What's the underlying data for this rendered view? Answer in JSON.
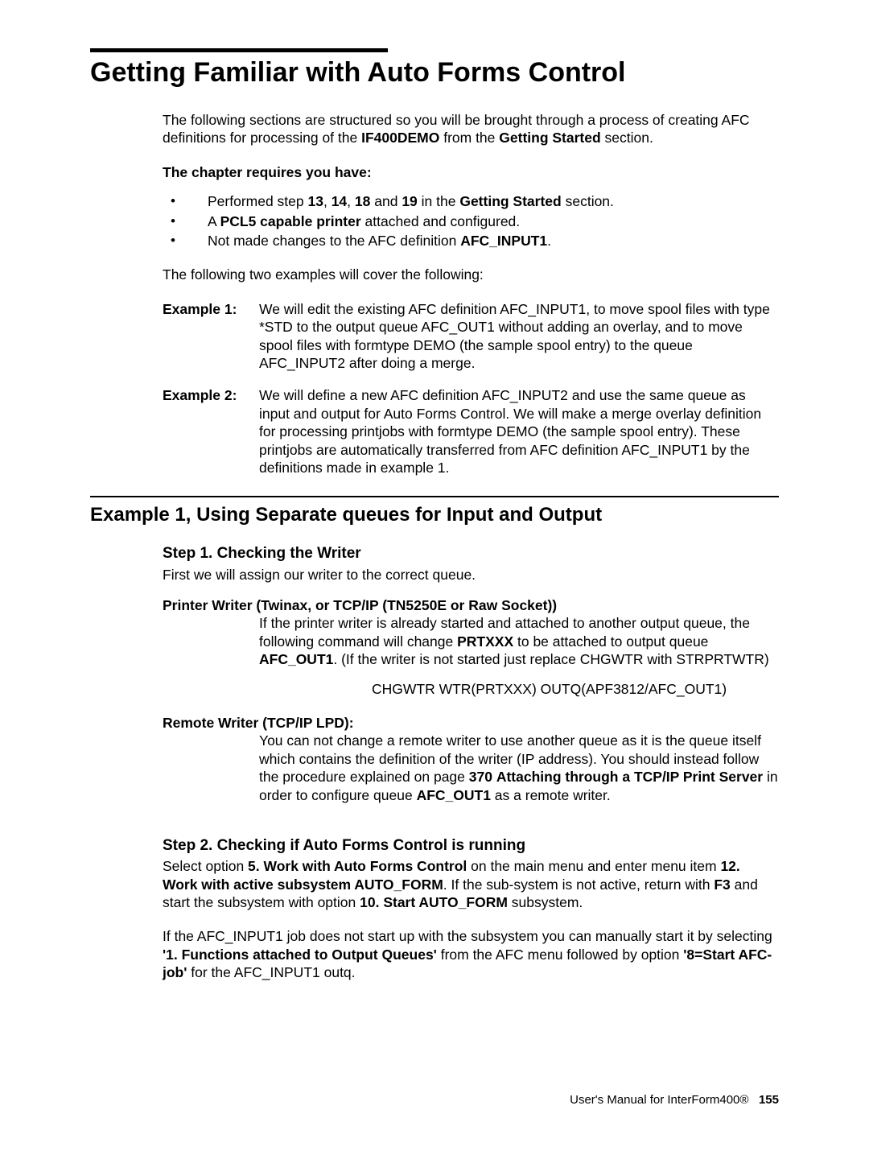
{
  "title": "Getting Familiar with Auto Forms Control",
  "intro": {
    "p1a": "The following sections are structured so you will be brought through a process of creating AFC definitions for processing of the ",
    "p1b": "IF400DEMO",
    "p1c": " from the ",
    "p1d": "Getting Started",
    "p1e": " section.",
    "req_head": "The chapter requires you have:",
    "req1a": "Performed step ",
    "req1_13": "13",
    "req1_c1": ", ",
    "req1_14": "14",
    "req1_c2": ", ",
    "req1_18": "18",
    "req1_and": " and ",
    "req1_19": "19",
    "req1_in": " in the ",
    "req1_gs": "Getting Started",
    "req1_end": " section.",
    "req2a": "A ",
    "req2b": "PCL5 capable printer",
    "req2c": " attached and configured.",
    "req3a": "Not made changes to the AFC definition ",
    "req3b": "AFC_INPUT1",
    "req3c": ".",
    "cover": "The following two examples will cover the following:",
    "ex1_label": "Example 1:",
    "ex1_text": "We will edit the existing AFC definition AFC_INPUT1, to move spool files with type *STD to the output queue AFC_OUT1 without adding an overlay, and to move spool files with formtype DEMO (the sample spool entry) to the queue AFC_INPUT2 after doing a merge.",
    "ex2_label": "Example 2:",
    "ex2_text": "We will define a new AFC definition AFC_INPUT2 and use the same queue as input and output for Auto Forms Control. We will make a merge overlay definition for processing printjobs with formtype DEMO (the sample spool entry). These printjobs are automatically transferred from AFC definition AFC_INPUT1 by the definitions made in example 1."
  },
  "section1": {
    "title": "Example 1, Using Separate queues for Input and Output",
    "step1": {
      "title": "Step 1. Checking the Writer",
      "lead": "First we will assign our writer to the correct queue.",
      "pw_head": "Printer Writer (Twinax, or TCP/IP (TN5250E or Raw Socket))",
      "pw_a": "If the printer writer is already started and attached to another output queue, the following command will change ",
      "pw_b": "PRTXXX",
      "pw_c": " to be attached to output queue ",
      "pw_d": "AFC_OUT1",
      "pw_e": ". (If the writer is not started just replace CHGWTR with STRPRTWTR)",
      "cmd": "CHGWTR WTR(PRTXXX) OUTQ(APF3812/AFC_OUT1)",
      "rw_head": "Remote Writer (TCP/IP LPD):",
      "rw_a": "You can not change a remote writer to use another queue as it is the queue itself which contains the definition of the writer (IP address). You should instead follow the procedure explained on page ",
      "rw_b": "370",
      "rw_ba": " ",
      "rw_c": "Attaching through a TCP/IP Print Server",
      "rw_d": " in order to configure queue ",
      "rw_e": "AFC_OUT1",
      "rw_f": " as a remote writer."
    },
    "step2": {
      "title": "Step 2. Checking if Auto Forms Control is running",
      "p1a": "Select option ",
      "p1b": "5. Work with Auto Forms Control",
      "p1c": " on the main menu and enter menu item ",
      "p1d": "12. Work with active subsystem AUTO_FORM",
      "p1e": ". If the sub-system is not active, return with ",
      "p1f": "F3",
      "p1g": " and start the subsystem with option ",
      "p1h": "10. Start AUTO_FORM",
      "p1i": " subsystem.",
      "p2a": "If the AFC_INPUT1 job does not start up with the subsystem you can manually start it by selecting ",
      "p2b": "'1. Functions attached to Output Queues'",
      "p2c": " from the AFC menu followed by option ",
      "p2d": "'8=Start AFC-job'",
      "p2e": " for the AFC_INPUT1 outq."
    }
  },
  "footer": {
    "text": "User's Manual for InterForm400®",
    "page": "155"
  }
}
